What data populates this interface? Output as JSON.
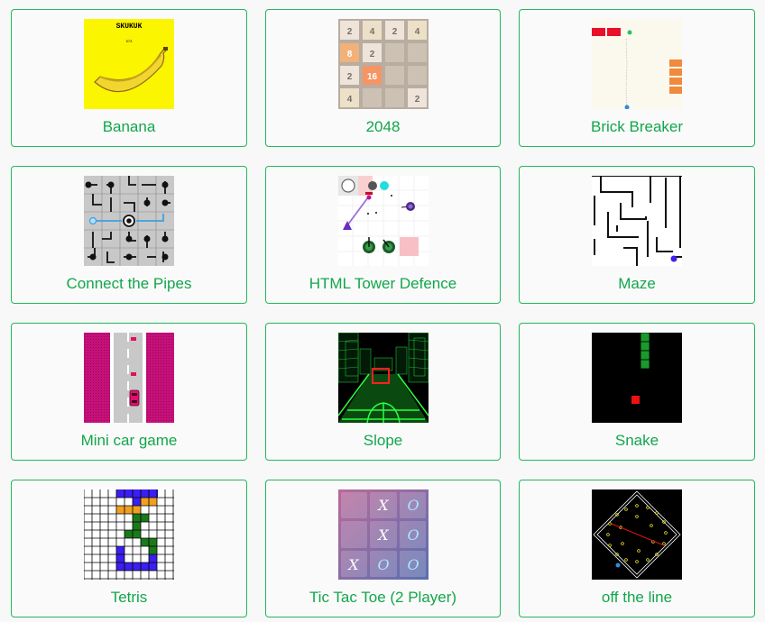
{
  "accent_color": "#12a64b",
  "border_color": "#22b85b",
  "games": [
    {
      "title": "Banana",
      "icon": "banana-thumbnail",
      "thumb_text": {
        "heading": "SKUKUK",
        "score": "573"
      }
    },
    {
      "title": "2048",
      "icon": "2048-board-thumbnail",
      "tiles": [
        "2",
        "4",
        "2",
        "4",
        "8",
        "2",
        "",
        "",
        "2",
        "16",
        "",
        "",
        "4",
        "",
        "",
        "2"
      ]
    },
    {
      "title": "Brick Breaker",
      "icon": "brick-breaker-thumbnail"
    },
    {
      "title": "Connect the Pipes",
      "icon": "pipes-board-thumbnail"
    },
    {
      "title": "HTML Tower Defence",
      "icon": "tower-defence-thumbnail"
    },
    {
      "title": "Maze",
      "icon": "maze-thumbnail"
    },
    {
      "title": "Mini car game",
      "icon": "car-road-thumbnail"
    },
    {
      "title": "Slope",
      "icon": "slope-neon-thumbnail"
    },
    {
      "title": "Snake",
      "icon": "snake-thumbnail"
    },
    {
      "title": "Tetris",
      "icon": "tetris-grid-thumbnail"
    },
    {
      "title": "Tic Tac Toe (2 Player)",
      "icon": "tic-tac-toe-thumbnail",
      "marks": [
        "",
        "X",
        "O",
        "",
        "X",
        "O",
        "X",
        "O",
        "O"
      ]
    },
    {
      "title": "off the line",
      "icon": "off-the-line-thumbnail"
    }
  ]
}
